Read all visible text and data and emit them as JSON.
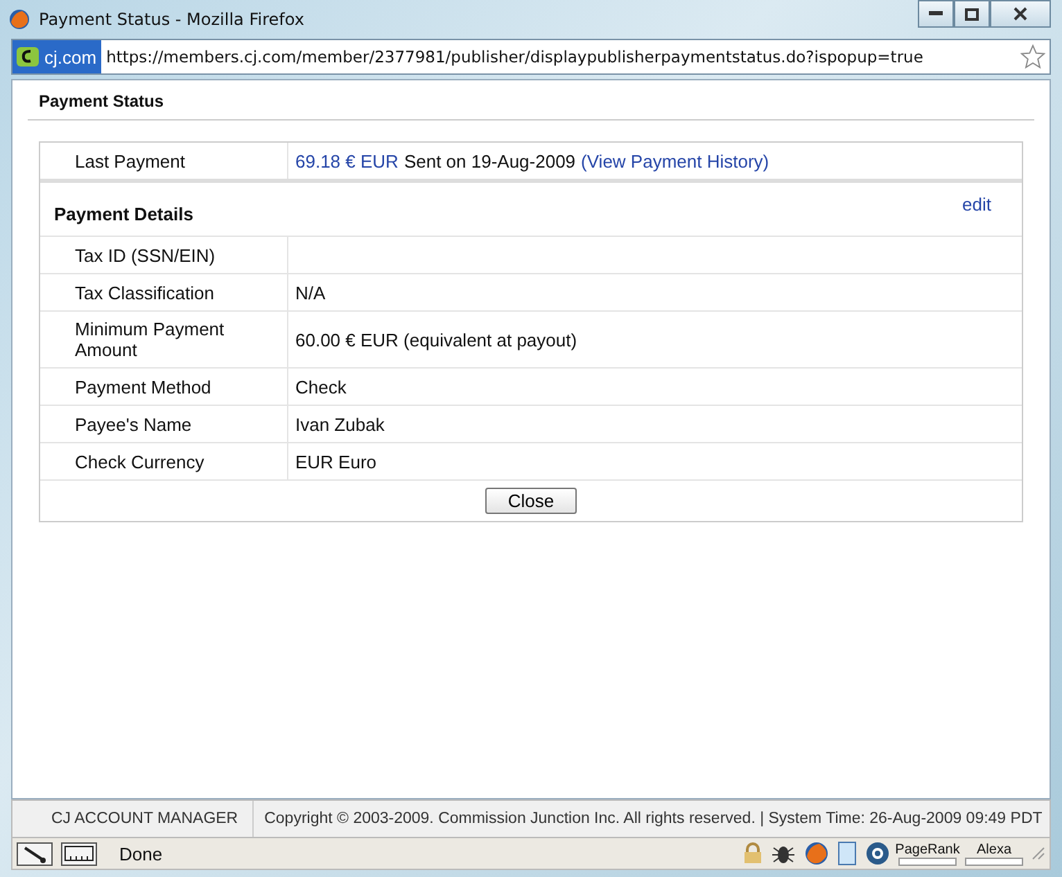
{
  "window": {
    "title": "Payment Status - Mozilla Firefox"
  },
  "address_bar": {
    "site_label": "cj.com",
    "url": "https://members.cj.com/member/2377981/publisher/displaypublisherpaymentstatus.do?ispopup=true"
  },
  "page": {
    "heading": "Payment Status",
    "last_payment": {
      "label": "Last Payment",
      "amount": "69.18 € EUR",
      "text": "Sent on 19-Aug-2009",
      "link": "(View Payment History)"
    },
    "details": {
      "heading": "Payment Details",
      "edit": "edit",
      "rows": [
        {
          "label": "Tax ID (SSN/EIN)"
        },
        {
          "label": "Tax Classification",
          "value": "N/A"
        },
        {
          "label": "Minimum Payment Amount",
          "value": "60.00 € EUR (equivalent at payout)"
        },
        {
          "label": "Payment Method",
          "value": "Check"
        },
        {
          "label": "Payee's Name",
          "value": "Ivan Zubak"
        },
        {
          "label": "Check Currency",
          "value": "EUR Euro"
        }
      ]
    },
    "close": "Close"
  },
  "footer": {
    "left": "CJ ACCOUNT MANAGER",
    "copyright": "Copyright © 2003-2009. Commission Junction Inc. All rights reserved. | System Time: 26-Aug-2009 09:49 PDT"
  },
  "status_bar": {
    "text": "Done",
    "widgets": [
      "PageRank",
      "Alexa"
    ]
  }
}
